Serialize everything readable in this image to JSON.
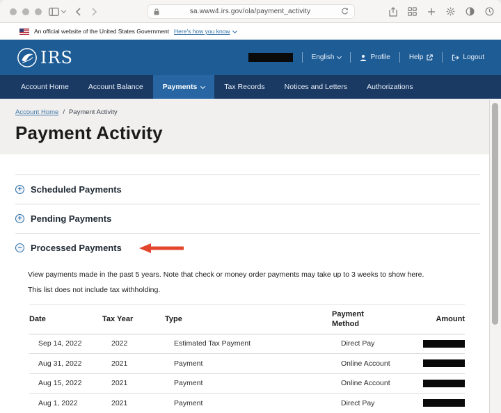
{
  "browser": {
    "url": "sa.www4.irs.gov/ola/payment_activity"
  },
  "gov_banner": {
    "text": "An official website of the United States Government",
    "link_label": "Here's how you know"
  },
  "header": {
    "logo_text": "IRS",
    "account_name_redacted": true,
    "language_label": "English",
    "profile_label": "Profile",
    "help_label": "Help",
    "logout_label": "Logout"
  },
  "nav": {
    "items": [
      {
        "label": "Account Home",
        "active": false
      },
      {
        "label": "Account Balance",
        "active": false
      },
      {
        "label": "Payments",
        "active": true,
        "dropdown": true
      },
      {
        "label": "Tax Records",
        "active": false
      },
      {
        "label": "Notices and Letters",
        "active": false
      },
      {
        "label": "Authorizations",
        "active": false
      }
    ]
  },
  "breadcrumb": {
    "home": "Account Home",
    "separator": "/",
    "current": "Payment Activity"
  },
  "page": {
    "title": "Payment Activity"
  },
  "accordions": [
    {
      "label": "Scheduled Payments",
      "icon": "+",
      "expanded": false
    },
    {
      "label": "Pending Payments",
      "icon": "+",
      "expanded": false
    },
    {
      "label": "Processed Payments",
      "icon": "−",
      "expanded": true,
      "annotated_with_red_arrow": true
    }
  ],
  "processed": {
    "description": "View payments made in the past 5 years. Note that check or money order payments may take up to 3 weeks to show here.",
    "note": "This list does not include tax withholding.",
    "table": {
      "headers": [
        "Date",
        "Tax Year",
        "Type",
        "Payment Method",
        "Amount"
      ],
      "rows": [
        {
          "date": "Sep 14, 2022",
          "tax_year": "2022",
          "type": "Estimated Tax Payment",
          "method": "Direct Pay",
          "amount_redacted": true
        },
        {
          "date": "Aug 31, 2022",
          "tax_year": "2021",
          "type": "Payment",
          "method": "Online Account",
          "amount_redacted": true
        },
        {
          "date": "Aug 15, 2022",
          "tax_year": "2021",
          "type": "Payment",
          "method": "Online Account",
          "amount_redacted": true
        },
        {
          "date": "Aug 1, 2022",
          "tax_year": "2021",
          "type": "Payment",
          "method": "Direct Pay",
          "amount_redacted": true
        }
      ]
    }
  },
  "icons": {
    "us-flag-icon": "css-striped-flag",
    "lock-icon": "svg-padlock",
    "refresh-icon": "svg-circular-arrow",
    "share-icon": "svg-box-up-arrow",
    "tab-grid-icon": "svg-four-squares",
    "new-tab-icon": "plus-glyph",
    "extensions-icon": "svg-gear-flower",
    "contrast-icon": "svg-half-circle",
    "clock-icon": "svg-clock",
    "sidebar-icon": "svg-split-rect",
    "profile-icon": "svg-person",
    "external-link-icon": "svg-box-arrow",
    "logout-icon": "svg-exit-arrow",
    "irs-eagle-logo": "svg-emblem",
    "red-annotation-arrow": "svg-left-arrow"
  },
  "colors": {
    "header_blue": "#1e5c96",
    "nav_navy": "#1a3a64",
    "nav_active_blue": "#2766a3",
    "link_blue": "#2e6da4",
    "title_band_gray": "#f1f0ee",
    "annotation_red": "#e2462c",
    "redaction_black": "#0a0a0a"
  }
}
